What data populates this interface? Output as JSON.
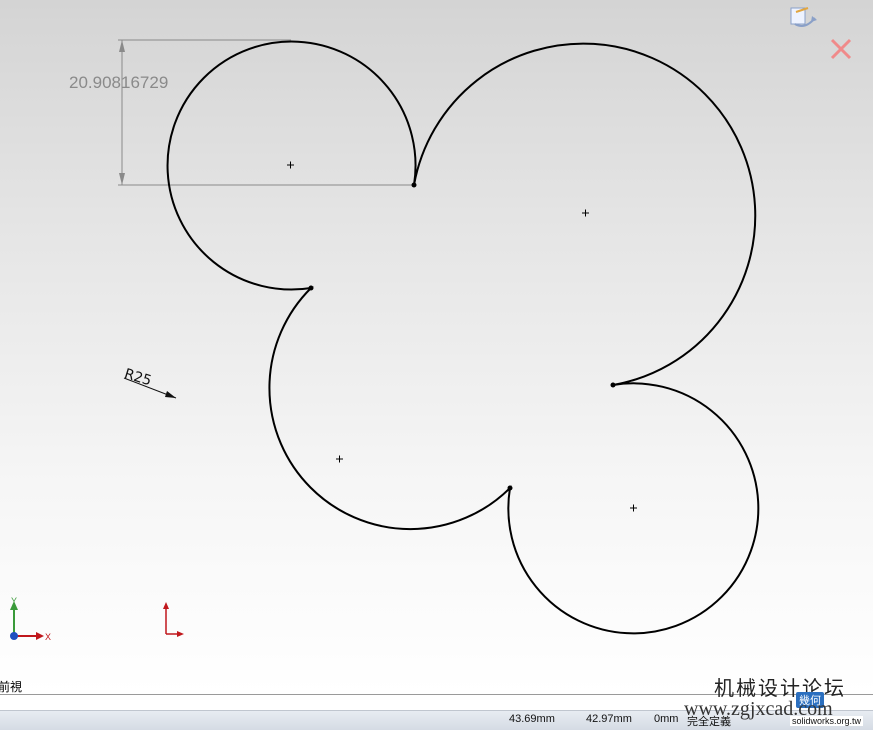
{
  "sketch": {
    "dimension_linear": "20.90816729",
    "dimension_radius": "R25"
  },
  "view": {
    "name": "前視"
  },
  "axis": {
    "x_label": "X",
    "y_label": "Y"
  },
  "statusbar": {
    "x_coord": "43.69mm",
    "y_coord": "42.97mm",
    "z_coord": "0mm",
    "state": "完全定義"
  },
  "watermark": {
    "forum_name": "机械设计论坛",
    "url": "www.zgjxcad.com",
    "site": "solidworks.org.tw",
    "badge": "幾何"
  },
  "colors": {
    "sketch_line": "#000000",
    "dimension": "#8a8a8a",
    "origin_red": "#c0171c",
    "axis_blue": "#1f4fbf",
    "axis_green": "#3a9a3a"
  },
  "icons": [
    "confirm-corner-icon",
    "cancel-corner-icon",
    "triad-icon",
    "origin-icon"
  ]
}
